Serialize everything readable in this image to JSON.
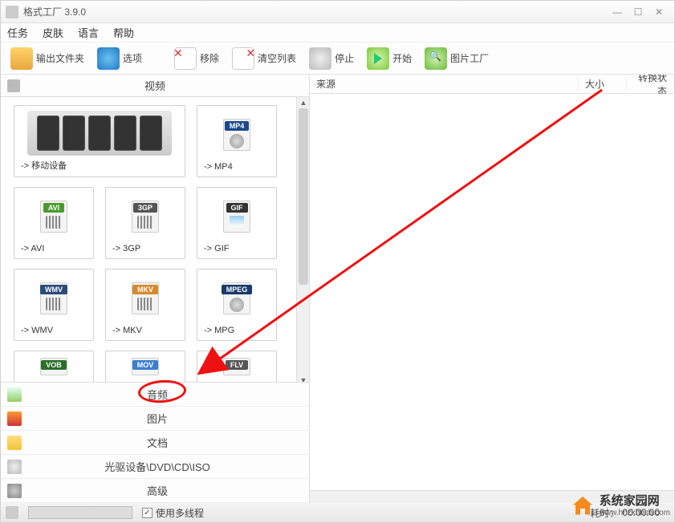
{
  "title": "格式工厂 3.9.0",
  "menu": {
    "task": "任务",
    "skin": "皮肤",
    "lang": "语言",
    "help": "帮助"
  },
  "toolbar": {
    "output": "输出文件夹",
    "options": "选项",
    "remove": "移除",
    "clear": "清空列表",
    "stop": "停止",
    "start": "开始",
    "picfactory": "图片工厂"
  },
  "left": {
    "video_header": "视频",
    "cards": {
      "mobile": "-> 移动设备",
      "mp4": "-> MP4",
      "avi": "-> AVI",
      "3gp": "-> 3GP",
      "gif": "-> GIF",
      "wmv": "-> WMV",
      "mkv": "-> MKV",
      "mpg": "-> MPG"
    },
    "badges": {
      "mp4": "MP4",
      "avi": "AVI",
      "3gp": "3GP",
      "gif": "GIF",
      "wmv": "WMV",
      "mkv": "MKV",
      "mpeg": "MPEG",
      "vob": "VOB",
      "mov": "MOV",
      "flv": "FLV"
    },
    "cats": {
      "audio": "音频",
      "pic": "图片",
      "doc": "文档",
      "dvd": "光驱设备\\DVD\\CD\\ISO",
      "adv": "高级"
    }
  },
  "right": {
    "col_src": "来源",
    "col_size": "大小",
    "col_status": "转换状态"
  },
  "status": {
    "multithread": "使用多线程",
    "time_label": "耗时：",
    "time_val": "00:00:00"
  },
  "wm": {
    "name": "系统家园网",
    "url": "www.hnzkhbsb.com"
  },
  "colors": {
    "avi": "#4a9b2f",
    "gif": "#333",
    "wmv": "#2a4a7a",
    "mkv": "#d68a2e",
    "mpeg": "#1a3a6a",
    "vob": "#2a6e2a",
    "mov": "#3a7fd0",
    "flv": "#555",
    "mp4": "#1a4a8a"
  }
}
